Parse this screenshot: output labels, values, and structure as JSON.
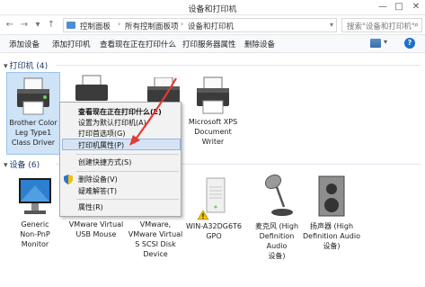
{
  "window": {
    "title": "设备和打印机",
    "minimize": "—",
    "maximize": "□",
    "close": "✕"
  },
  "nav": {
    "back": "←",
    "forward": "→",
    "recent": "▾",
    "up": "↑"
  },
  "address": {
    "crumbs": [
      "控制面板",
      "所有控制面板项",
      "设备和打印机"
    ],
    "separator": "›",
    "dropdown": "▾"
  },
  "search": {
    "placeholder": "搜索\"设备和打印机\"",
    "icon": "search-icon"
  },
  "commands": [
    "添加设备",
    "添加打印机",
    "查看现在正在打印什么",
    "打印服务器属性",
    "删除设备"
  ],
  "view_dropdown": "▾",
  "help_label": "?",
  "sections": {
    "printers": {
      "title": "打印机 (4)",
      "chevron": "▾"
    },
    "devices": {
      "title": "设备 (6)",
      "chevron": "▾"
    }
  },
  "printers": [
    {
      "name": "Brother Color\nLeg Type1\nClass Driver",
      "icon": "printer-icon",
      "selected": true
    },
    {
      "name": "",
      "icon": "printer-icon"
    },
    {
      "name": "",
      "icon": "printer-icon"
    },
    {
      "name": "Microsoft XPS\nDocument\nWriter",
      "icon": "printer-icon"
    }
  ],
  "devices": [
    {
      "name": "Generic\nNon-PnP\nMonitor",
      "icon": "monitor-icon"
    },
    {
      "name": "VMware Virtual\nUSB Mouse",
      "icon": "mouse-icon"
    },
    {
      "name": "VMware,\nVMware Virtual\nS SCSI Disk\nDevice",
      "icon": "disk-icon"
    },
    {
      "name": "WIN-A32DG6T6\nGPO",
      "icon": "computer-icon",
      "warning": true
    },
    {
      "name": "麦克风 (High\nDefinition Audio\n设备)",
      "icon": "microphone-icon"
    },
    {
      "name": "扬声器 (High\nDefinition Audio\n设备)",
      "icon": "speaker-icon"
    }
  ],
  "context_menu": {
    "items": [
      {
        "label": "查看现在正在打印什么(E)",
        "bold": true
      },
      {
        "label": "设置为默认打印机(A)"
      },
      {
        "label": "打印首选项(G)"
      },
      {
        "label": "打印机属性(P)",
        "highlighted": true
      },
      {
        "label": "创建快捷方式(S)"
      },
      {
        "label": "删除设备(V)",
        "shield": true
      },
      {
        "label": "疑难解答(T)"
      },
      {
        "label": "属性(R)"
      }
    ]
  },
  "colors": {
    "accent": "#1e6fc8",
    "annotation_arrow": "#e53935",
    "selection": "#cfe3f7",
    "menu_highlight": "#d5e4f5"
  }
}
